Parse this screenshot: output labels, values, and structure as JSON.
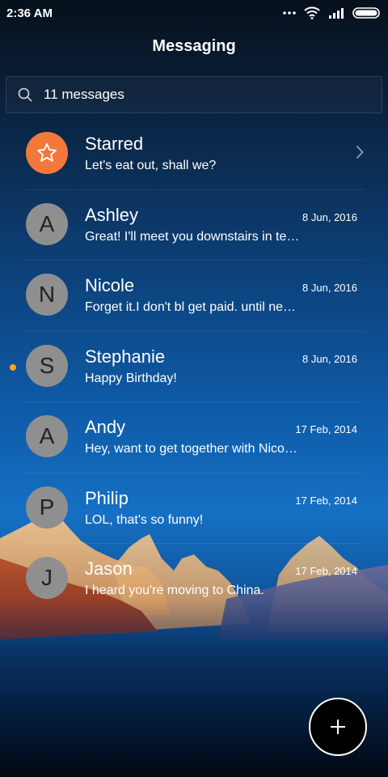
{
  "status_bar": {
    "time": "2:36 AM",
    "icons": [
      "more-dots-icon",
      "wifi-icon",
      "signal-icon",
      "battery-icon"
    ]
  },
  "header": {
    "title": "Messaging"
  },
  "search": {
    "text": "11 messages",
    "icon": "search-icon"
  },
  "conversations": [
    {
      "avatar": "",
      "icon": "star-icon",
      "name": "Starred",
      "date": "",
      "preview": "Let's eat out, shall we?",
      "unread": false
    },
    {
      "avatar": "A",
      "name": "Ashley",
      "date": "8 Jun, 2016",
      "preview": "Great! I'll meet you downstairs in te…",
      "unread": false
    },
    {
      "avatar": "N",
      "name": "Nicole",
      "date": "8 Jun, 2016",
      "preview": "Forget it.I don't bl get paid. until ne…",
      "unread": false
    },
    {
      "avatar": "S",
      "name": "Stephanie",
      "date": "8 Jun, 2016",
      "preview": "Happy Birthday!",
      "unread": true
    },
    {
      "avatar": "A",
      "name": "Andy",
      "date": "17 Feb, 2014",
      "preview": "Hey, want to get together with Nico…",
      "unread": false
    },
    {
      "avatar": "P",
      "name": "Philip",
      "date": "17 Feb, 2014",
      "preview": "LOL, that's so funny!",
      "unread": false
    },
    {
      "avatar": "J",
      "name": "Jason",
      "date": "17 Feb, 2014",
      "preview": "I heard you're moving to China.",
      "unread": false
    }
  ],
  "fab": {
    "icon": "plus-icon"
  },
  "colors": {
    "starred_avatar": "#f2793a",
    "unread_dot": "#f5a623",
    "avatar_bg": "#8f8f8f"
  }
}
